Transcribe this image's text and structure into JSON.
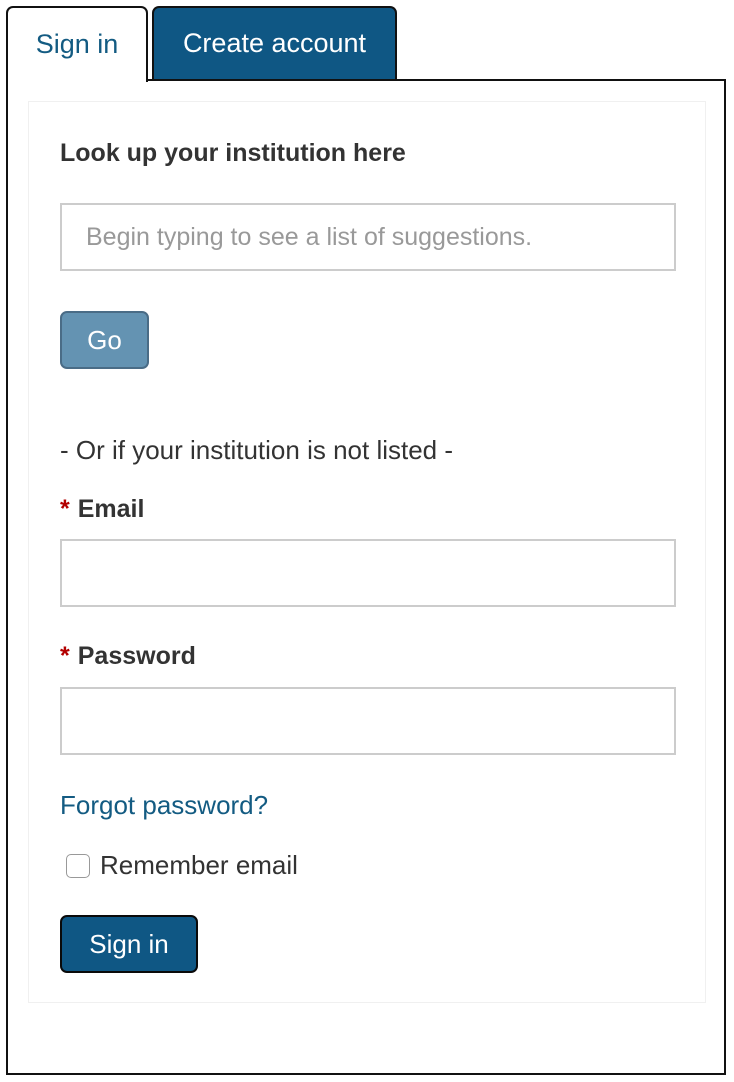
{
  "tabs": {
    "sign_in": "Sign in",
    "create_account": "Create account"
  },
  "institution": {
    "label": "Look up your institution here",
    "placeholder": "Begin typing to see a list of suggestions.",
    "value": "",
    "go_label": "Go"
  },
  "divider_text": "- Or if your institution is not listed -",
  "email": {
    "required_mark": "*",
    "label": "Email",
    "value": ""
  },
  "password": {
    "required_mark": "*",
    "label": "Password",
    "value": ""
  },
  "forgot_password": "Forgot password?",
  "remember_email": {
    "label": "Remember email",
    "checked": false
  },
  "sign_in_button": "Sign in",
  "colors": {
    "primary": "#0f5784",
    "go_button": "#6493b2",
    "link": "#135b82",
    "required": "#b30000"
  }
}
